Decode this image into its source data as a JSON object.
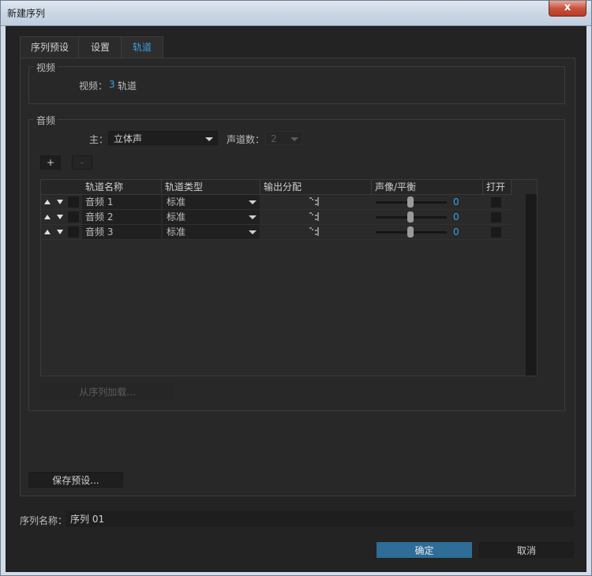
{
  "window": {
    "title": "新建序列",
    "close_glyph": "x"
  },
  "tabs": [
    {
      "label": "序列预设",
      "active": false
    },
    {
      "label": "设置",
      "active": false
    },
    {
      "label": "轨道",
      "active": true
    }
  ],
  "video": {
    "group_label": "视频",
    "label": "视频：",
    "count": "3",
    "unit": "轨道"
  },
  "audio": {
    "group_label": "音频",
    "master_label": "主：",
    "master_value": "立体声",
    "channels_label": "声道数：",
    "channels_value": "2",
    "add_label": "+",
    "remove_label": "-",
    "columns": [
      "轨道名称",
      "轨道类型",
      "输出分配",
      "声像/平衡",
      "打开"
    ],
    "rows": [
      {
        "name": "音频 1",
        "type": "标准",
        "pan": "0"
      },
      {
        "name": "音频 2",
        "type": "标准",
        "pan": "0"
      },
      {
        "name": "音频 3",
        "type": "标准",
        "pan": "0"
      }
    ],
    "load_label": "从序列加载..."
  },
  "save_preset_label": "保存预设...",
  "sequence_name": {
    "label": "序列名称：",
    "value": "序列 01"
  },
  "footer": {
    "ok_label": "确定",
    "cancel_label": "取消"
  },
  "icons": {
    "close": "close-icon",
    "dropdown": "chevron-down-icon",
    "output": "output-routing-icon"
  },
  "colors": {
    "accent": "#3aa0e0",
    "primary_button": "#2e6d96"
  }
}
